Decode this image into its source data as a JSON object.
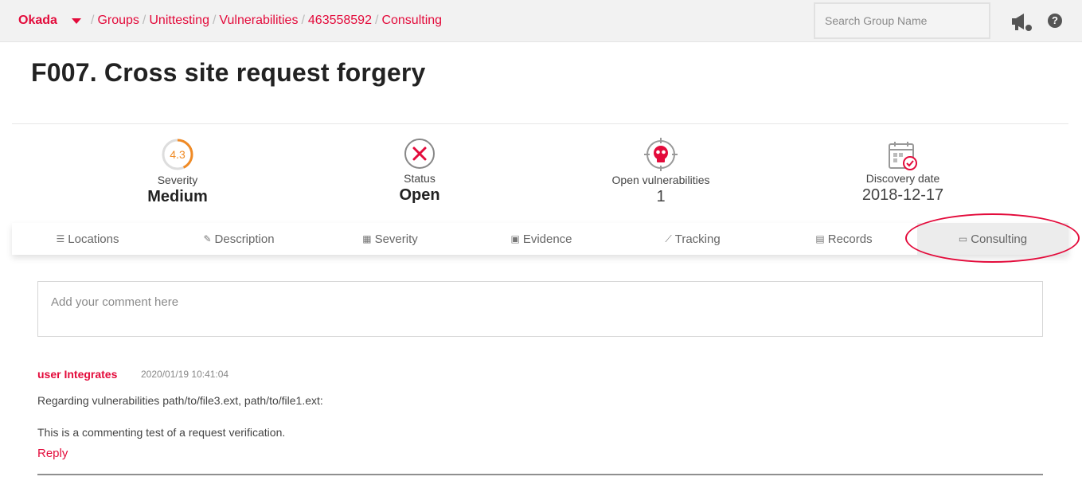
{
  "header": {
    "brand": "Okada",
    "breadcrumb": [
      "Groups",
      "Unittesting",
      "Vulnerabilities",
      "463558592",
      "Consulting"
    ],
    "search_placeholder": "Search Group Name",
    "help_glyph": "?",
    "icons": [
      "chevron-down-icon",
      "megaphone-icon",
      "help-icon"
    ]
  },
  "finding": {
    "title": "F007. Cross site request forgery"
  },
  "indicators": {
    "severity": {
      "score": "4.3",
      "score_fraction": 0.43,
      "label": "Severity",
      "value": "Medium",
      "color": "#f08a24"
    },
    "status": {
      "label": "Status",
      "value": "Open",
      "color": "#e30b3b"
    },
    "open_vulns": {
      "label": "Open vulnerabilities",
      "value": "1"
    },
    "discovery": {
      "label": "Discovery date",
      "value": "2018-12-17"
    }
  },
  "tabs": [
    {
      "label": "Locations",
      "icon": "list-icon"
    },
    {
      "label": "Description",
      "icon": "edit-icon"
    },
    {
      "label": "Severity",
      "icon": "calculator-icon"
    },
    {
      "label": "Evidence",
      "icon": "image-icon"
    },
    {
      "label": "Tracking",
      "icon": "chart-line-icon"
    },
    {
      "label": "Records",
      "icon": "book-icon"
    },
    {
      "label": "Consulting",
      "icon": "comment-icon",
      "active": true
    }
  ],
  "consulting": {
    "comment_placeholder": "Add your comment here",
    "comments": [
      {
        "author": "user Integrates",
        "timestamp": "2020/01/19 10:41:04",
        "line1": "Regarding vulnerabilities path/to/file3.ext, path/to/file1.ext:",
        "line2": "This is a commenting test of a request verification.",
        "reply_label": "Reply"
      }
    ]
  },
  "colors": {
    "accent": "#e30b3b",
    "topbar": "#f2f2f2"
  }
}
